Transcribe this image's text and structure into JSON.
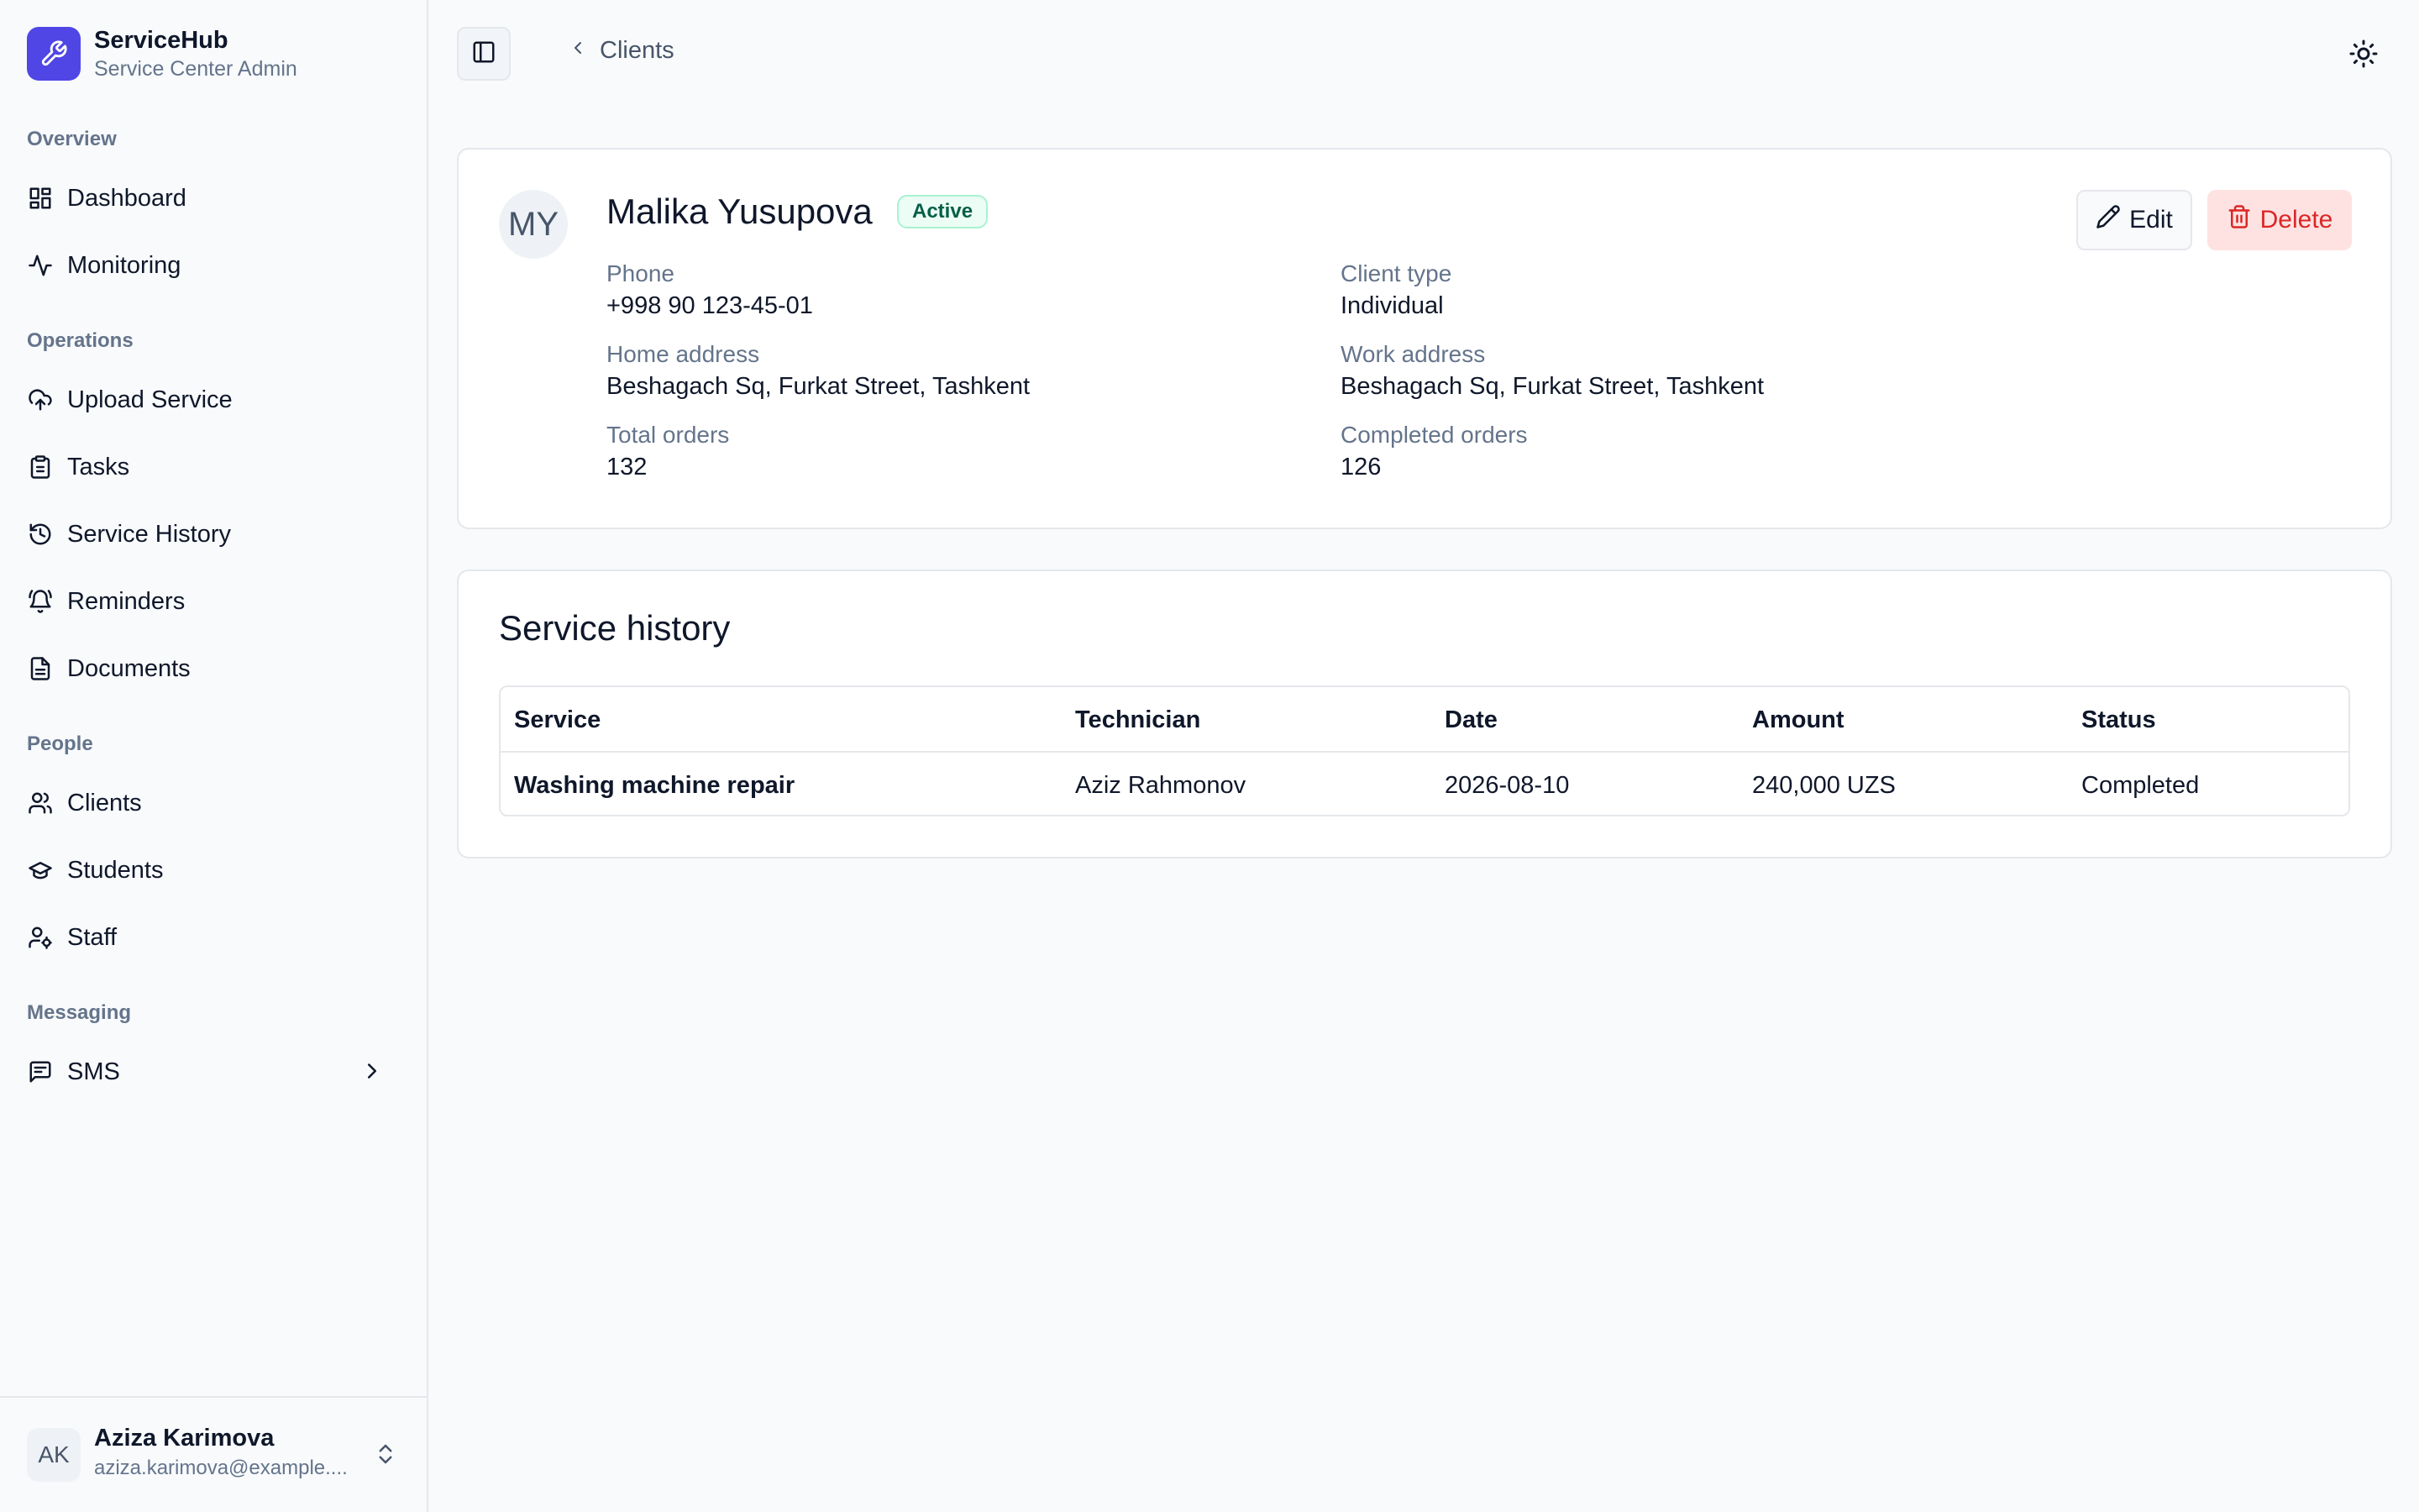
{
  "brand": {
    "name": "ServiceHub",
    "subtitle": "Service Center Admin",
    "accent": "#4f46e5",
    "icon": "wrench-icon"
  },
  "sidebar": {
    "groups": {
      "overview": "Overview",
      "operations": "Operations",
      "people": "People",
      "messaging": "Messaging"
    },
    "items": {
      "dashboard": {
        "label": "Dashboard",
        "icon": "dashboard-icon"
      },
      "monitoring": {
        "label": "Monitoring",
        "icon": "activity-icon"
      },
      "upload_service": {
        "label": "Upload Service",
        "icon": "cloud-upload-icon"
      },
      "tasks": {
        "label": "Tasks",
        "icon": "clipboard-icon"
      },
      "service_history": {
        "label": "Service History",
        "icon": "history-icon"
      },
      "reminders": {
        "label": "Reminders",
        "icon": "bell-icon"
      },
      "documents": {
        "label": "Documents",
        "icon": "file-icon"
      },
      "clients": {
        "label": "Clients",
        "icon": "users-icon"
      },
      "students": {
        "label": "Students",
        "icon": "graduation-cap-icon"
      },
      "staff": {
        "label": "Staff",
        "icon": "user-cog-icon"
      },
      "sms": {
        "label": "SMS",
        "icon": "message-square-icon"
      }
    }
  },
  "user": {
    "initials": "AK",
    "name": "Aziza Karimova",
    "email": "aziza.karimova@example...."
  },
  "header": {
    "breadcrumb": "Clients"
  },
  "client": {
    "initials": "MY",
    "name": "Malika Yusupova",
    "status": "Active",
    "actions": {
      "edit": "Edit",
      "delete": "Delete"
    },
    "fields": {
      "phone": {
        "label": "Phone",
        "value": "+998 90 123-45-01"
      },
      "client_type": {
        "label": "Client type",
        "value": "Individual"
      },
      "home_address": {
        "label": "Home address",
        "value": "Beshagach Sq, Furkat Street, Tashkent"
      },
      "work_address": {
        "label": "Work address",
        "value": "Beshagach Sq, Furkat Street, Tashkent"
      },
      "total_orders": {
        "label": "Total orders",
        "value": "132"
      },
      "completed_orders": {
        "label": "Completed orders",
        "value": "126"
      }
    }
  },
  "service_history": {
    "title": "Service history",
    "columns": [
      "Service",
      "Technician",
      "Date",
      "Amount",
      "Status"
    ],
    "rows": [
      [
        "Washing machine repair",
        "Aziz Rahmonov",
        "2026-08-10",
        "240,000 UZS",
        "Completed"
      ]
    ]
  }
}
